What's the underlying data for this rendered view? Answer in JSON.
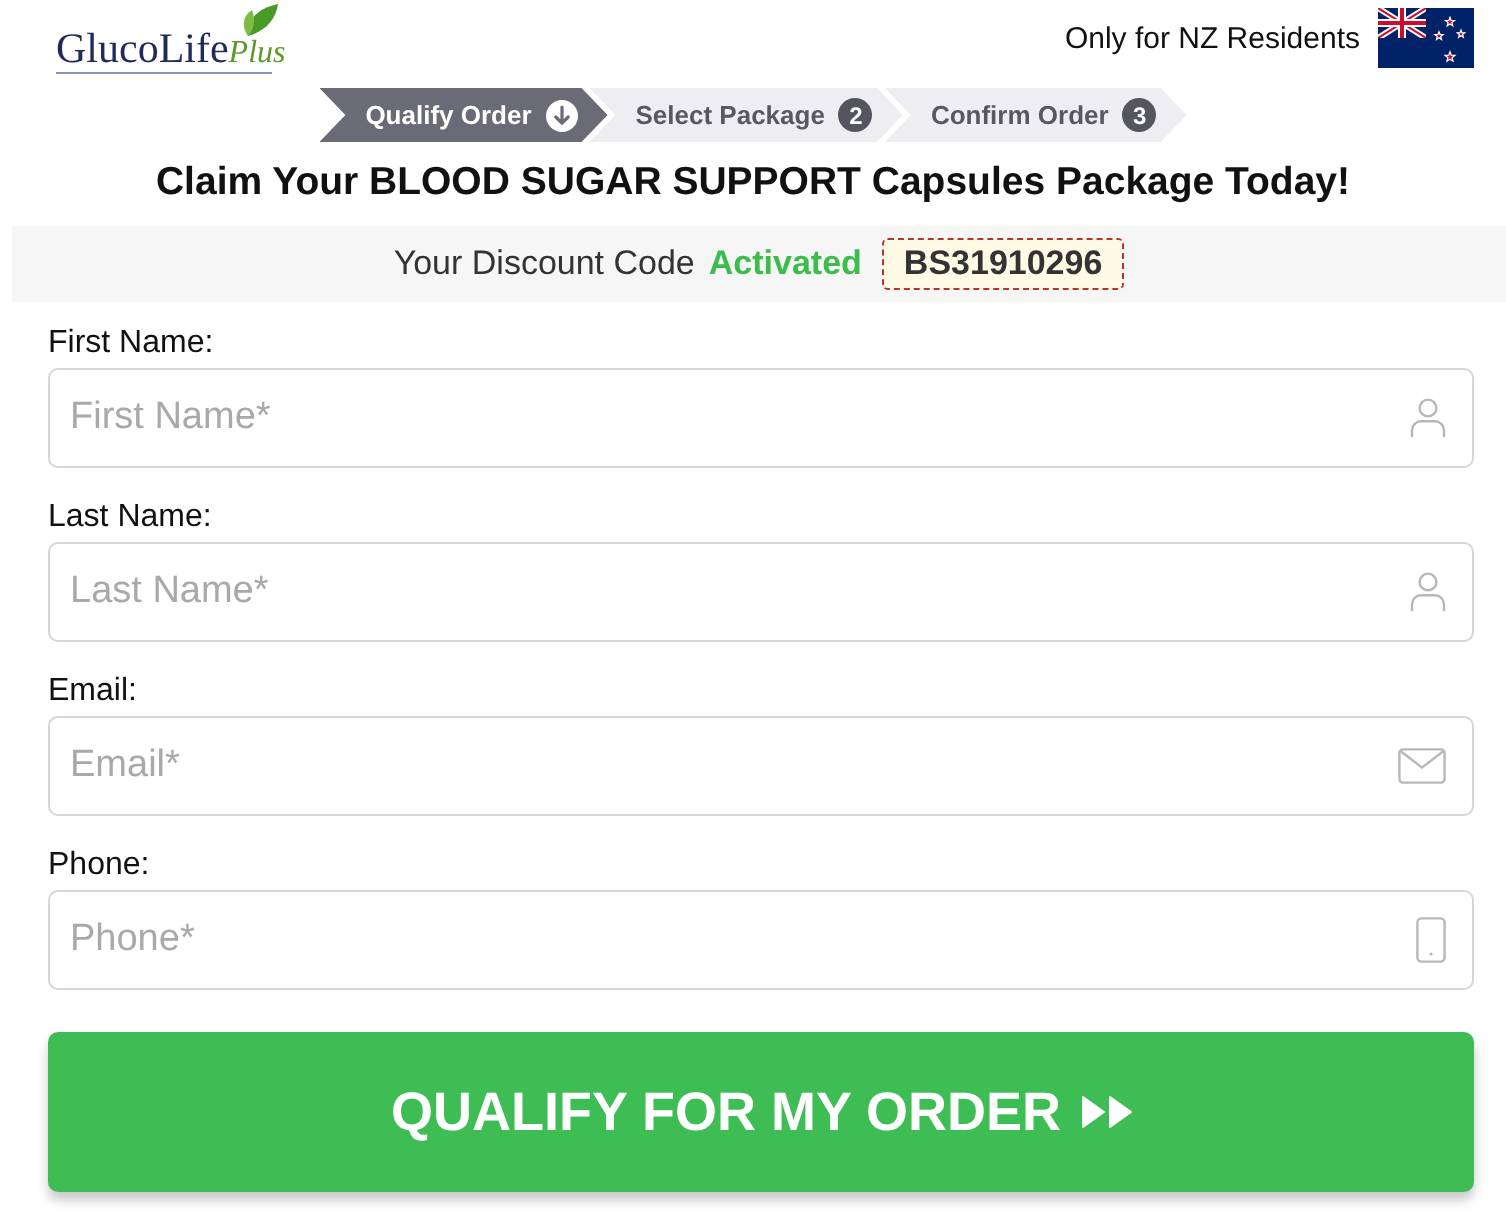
{
  "header": {
    "brand": "GlucoLife",
    "brand_suffix": "Plus",
    "notice": "Only for NZ Residents"
  },
  "steps": [
    {
      "label": "Qualify Order",
      "selected": true
    },
    {
      "label": "Select Package",
      "number": "2",
      "selected": false
    },
    {
      "label": "Confirm Order",
      "number": "3",
      "selected": false
    }
  ],
  "headline": "Claim Your BLOOD SUGAR SUPPORT Capsules Package Today!",
  "discount": {
    "label": "Your Discount Code",
    "status": "Activated",
    "code": "BS31910296"
  },
  "fields": [
    {
      "label": "First Name:",
      "placeholder": "First Name*",
      "kind": "person"
    },
    {
      "label": "Last Name:",
      "placeholder": "Last Name*",
      "kind": "person"
    },
    {
      "label": "Email:",
      "placeholder": "Email*",
      "kind": "mail"
    },
    {
      "label": "Phone:",
      "placeholder": "Phone*",
      "kind": "phone"
    }
  ],
  "submit": {
    "label": "QUALIFY FOR MY ORDER"
  }
}
